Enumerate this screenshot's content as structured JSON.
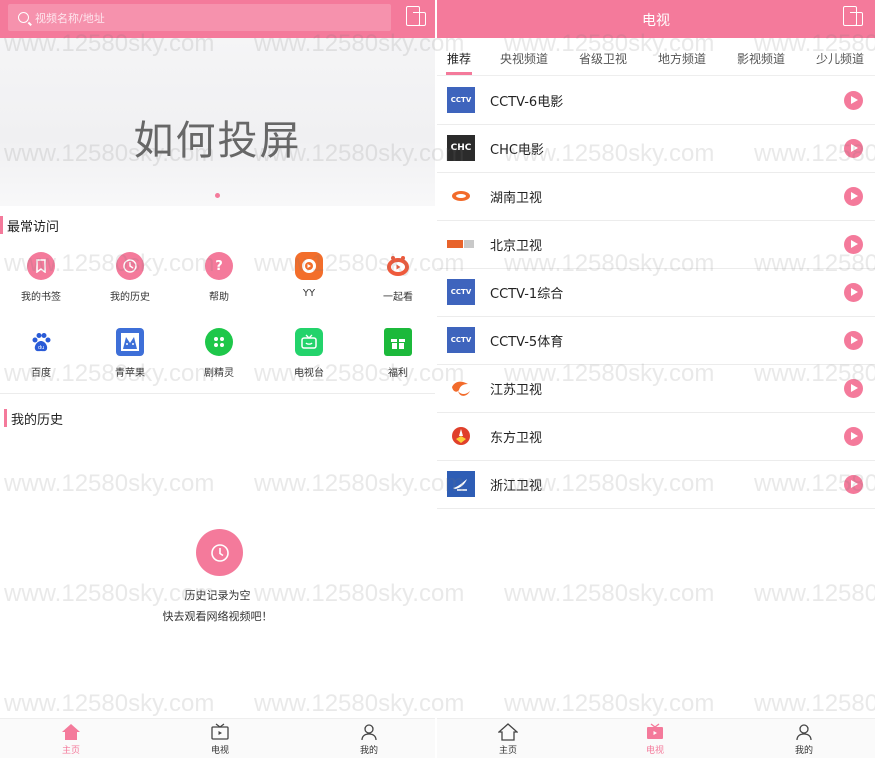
{
  "left": {
    "search_placeholder": "视频名称/地址",
    "banner_text": "如何投屏",
    "frequent_title": "最常访问",
    "frequent_items": [
      {
        "label": "我的书签",
        "icon": "bookmark-icon"
      },
      {
        "label": "我的历史",
        "icon": "history-icon"
      },
      {
        "label": "帮助",
        "icon": "help-icon"
      },
      {
        "label": "YY",
        "icon": "yy-icon"
      },
      {
        "label": "一起看",
        "icon": "watch-together-icon"
      },
      {
        "label": "百度",
        "icon": "baidu-icon"
      },
      {
        "label": "青苹果",
        "icon": "green-apple-icon"
      },
      {
        "label": "剧精灵",
        "icon": "drama-elf-icon"
      },
      {
        "label": "电视台",
        "icon": "tv-station-icon"
      },
      {
        "label": "福利",
        "icon": "gift-icon"
      }
    ],
    "history_title": "我的历史",
    "empty_line1": "历史记录为空",
    "empty_line2": "快去观看网络视频吧！",
    "nav": {
      "home": "主页",
      "tv": "电视",
      "mine": "我的"
    }
  },
  "right": {
    "title": "电视",
    "tabs": [
      "推荐",
      "央视频道",
      "省级卫视",
      "地方频道",
      "影视频道",
      "少儿频道"
    ],
    "channels": [
      {
        "name": "CCTV-6电影",
        "logo": "CCTV"
      },
      {
        "name": "CHC电影",
        "logo": "CHC"
      },
      {
        "name": "湖南卫视",
        "logo": "hunan"
      },
      {
        "name": "北京卫视",
        "logo": "BTV"
      },
      {
        "name": "CCTV-1综合",
        "logo": "CCTV"
      },
      {
        "name": "CCTV-5体育",
        "logo": "CCTV"
      },
      {
        "name": "江苏卫视",
        "logo": "jiangsu"
      },
      {
        "name": "东方卫视",
        "logo": "dongfang"
      },
      {
        "name": "浙江卫视",
        "logo": "zhejiang"
      }
    ],
    "nav": {
      "home": "主页",
      "tv": "电视",
      "mine": "我的"
    }
  },
  "watermark_text": "www.12580sky.com",
  "colors": {
    "accent": "#f47a9b"
  }
}
